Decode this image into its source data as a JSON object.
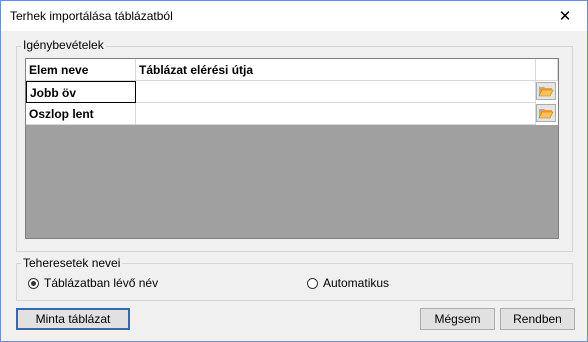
{
  "window": {
    "title": "Terhek importálása táblázatból",
    "close_symbol": "✕"
  },
  "usage_group": {
    "label": "Igénybevételek",
    "columns": [
      "Elem neve",
      "Táblázat elérési útja"
    ],
    "rows": [
      {
        "name": "Jobb öv",
        "path": ""
      },
      {
        "name": "Oszlop lent",
        "path": ""
      }
    ]
  },
  "loadcase_group": {
    "label": "Teheresetek nevei",
    "options": [
      {
        "label": "Táblázatban lévő név",
        "selected": true
      },
      {
        "label": "Automatikus",
        "selected": false
      }
    ]
  },
  "buttons": {
    "sample": "Minta táblázat",
    "cancel": "Mégsem",
    "ok": "Rendben"
  }
}
